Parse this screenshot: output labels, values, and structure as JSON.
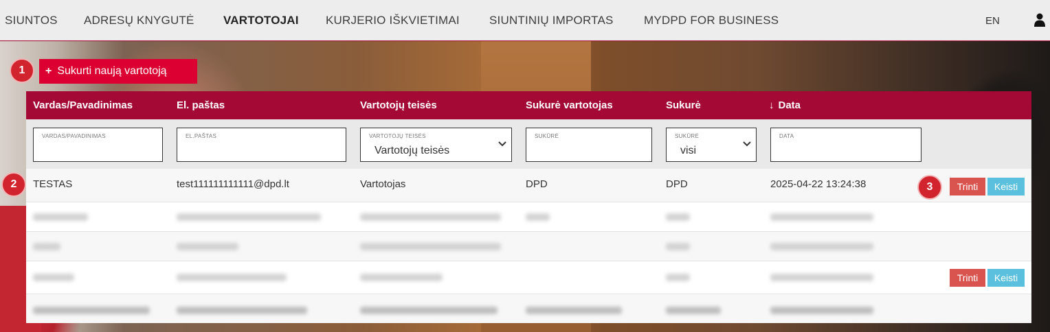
{
  "nav": {
    "items": [
      {
        "label": "SIUNTOS",
        "active": false
      },
      {
        "label": "ADRESŲ KNYGUTĖ",
        "active": false
      },
      {
        "label": "VARTOTOJAI",
        "active": true
      },
      {
        "label": "KURJERIO IŠKVIETIMAI",
        "active": false
      },
      {
        "label": "SIUNTINIŲ IMPORTAS",
        "active": false
      },
      {
        "label": "MYDPD FOR BUSINESS",
        "active": false
      }
    ],
    "lang": "EN",
    "user_icon": "user-icon"
  },
  "steps": [
    "1",
    "2",
    "3"
  ],
  "create_button": {
    "plus": "+",
    "label": "Sukurti naują vartotoją"
  },
  "table": {
    "columns": [
      "Vardas/Pavadinimas",
      "El. paštas",
      "Vartotojų teisės",
      "Sukurė vartotojas",
      "Sukurė",
      "Data"
    ],
    "sort_icon": "↓",
    "filters": {
      "name_label": "VARDAS/PAVADINIMAS",
      "email_label": "EL.PAŠTAS",
      "rights_label": "VARTOTOJŲ TEISĖS",
      "rights_value": "Vartotojų teisės",
      "creator_label": "SUKŪRĖ",
      "created_label": "SUKŪRĖ",
      "created_value": "visi",
      "date_label": "DATA"
    },
    "first_row": {
      "name": "TESTAS",
      "email": "test111111111111@dpd.lt",
      "rights": "Vartotojas",
      "creator_user": "DPD",
      "created_by": "DPD",
      "date": "2025-04-22 13:24:38"
    },
    "actions": {
      "delete": "Trinti",
      "edit": "Keisti"
    }
  },
  "colors": {
    "brand_red": "#dc0032",
    "header_bg": "#a40936",
    "delete_btn": "#d9534f",
    "edit_btn": "#5bc0de"
  }
}
